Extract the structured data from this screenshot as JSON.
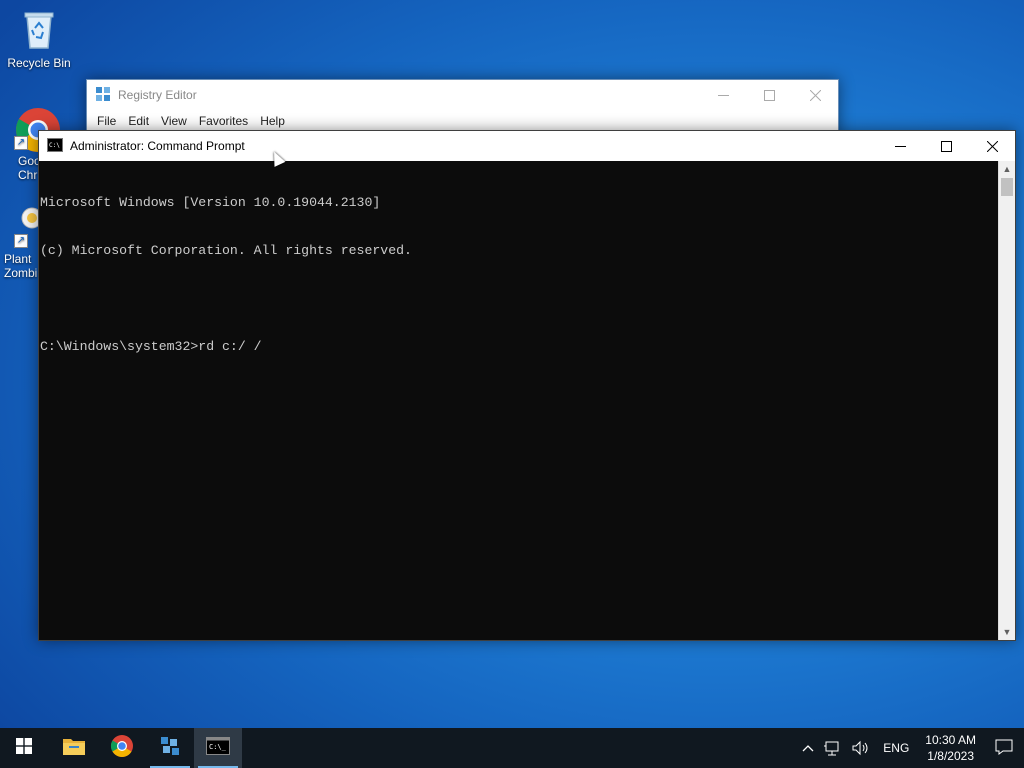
{
  "desktop": {
    "icons": [
      {
        "label": "Recycle Bin",
        "icon": "recycle-bin-icon"
      },
      {
        "label": "Goo\nChr",
        "icon": "chrome-icon"
      },
      {
        "label": "Plant\nZombi",
        "icon": "plants-vs-zombies-icon"
      }
    ]
  },
  "regedit": {
    "title": "Registry Editor",
    "menu": [
      "File",
      "Edit",
      "View",
      "Favorites",
      "Help"
    ]
  },
  "cmd": {
    "title": "Administrator: Command Prompt",
    "lines": [
      "Microsoft Windows [Version 10.0.19044.2130]",
      "(c) Microsoft Corporation. All rights reserved.",
      "",
      "C:\\Windows\\system32>rd c:/ /"
    ]
  },
  "taskbar": {
    "apps": [
      "start-icon",
      "file-explorer-icon",
      "chrome-icon",
      "registry-editor-icon",
      "command-prompt-icon"
    ],
    "tray": {
      "language": "ENG",
      "time": "10:30 AM",
      "date": "1/8/2023"
    }
  },
  "colors": {
    "taskbar": "#101820",
    "console_bg": "#0c0c0c",
    "console_fg": "#cccccc",
    "accent": "#76b9ed"
  }
}
